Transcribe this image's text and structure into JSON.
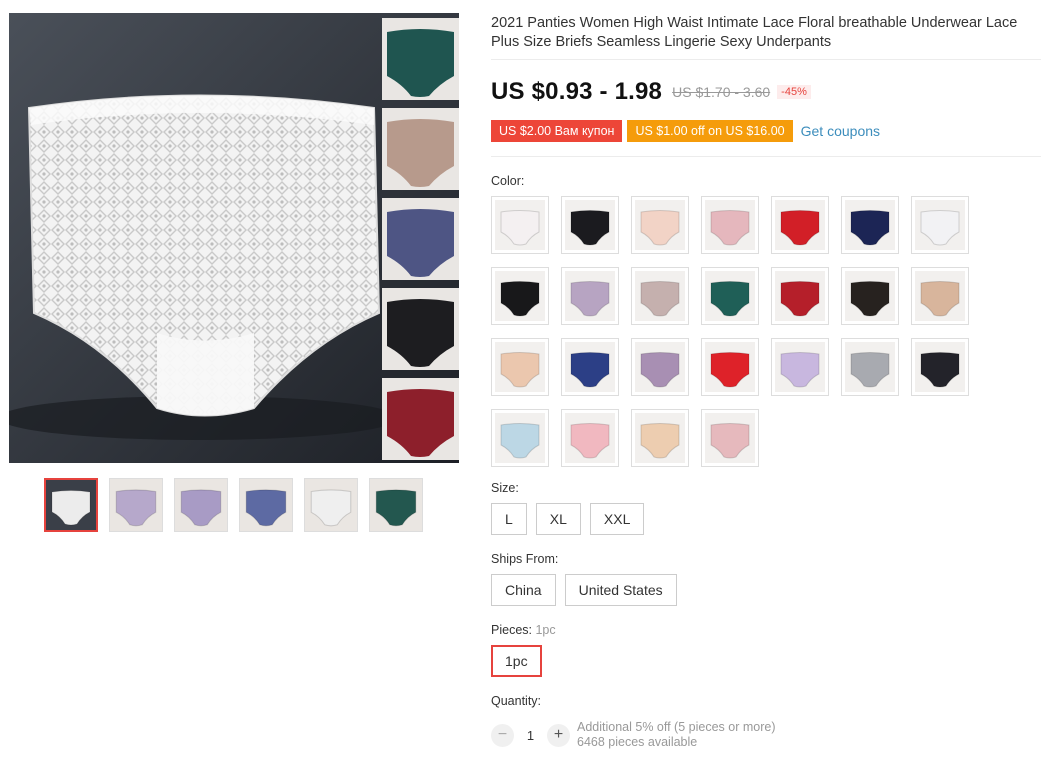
{
  "product": {
    "title": "2021 Panties Women High Waist Intimate Lace Floral breathable Underwear Lace Plus Size Briefs Seamless Lingerie Sexy Underpants"
  },
  "price": {
    "current": "US $0.93 - 1.98",
    "original": "US $1.70 - 3.60",
    "discount": "-45%"
  },
  "coupons": [
    {
      "label": "US $2.00 Вам купон",
      "color": "#ed4638"
    },
    {
      "label": "US $1.00 off on US $16.00",
      "color": "#f59c0b"
    }
  ],
  "get_coupons_label": "Get coupons",
  "color_label": "Color:",
  "colors": [
    "#f4f0f1",
    "#1b1b1f",
    "#f2d3c6",
    "#e5b7bd",
    "#d21f27",
    "#1c2555",
    "#f2f2f4",
    "#18181a",
    "#b7a4c2",
    "#c5b0ae",
    "#1f5f57",
    "#b51f2a",
    "#27221f",
    "#d8b59c",
    "#ebc7ae",
    "#2c3f86",
    "#a88fb3",
    "#de2229",
    "#c8b7df",
    "#a8aab0",
    "#23232a",
    "#bcd7e5",
    "#f1b8c0",
    "#edcdb0",
    "#e6b9bd"
  ],
  "size_label": "Size:",
  "sizes": [
    "L",
    "XL",
    "XXL"
  ],
  "ships_label": "Ships From:",
  "ships": [
    "China",
    "United States"
  ],
  "pieces_label": "Pieces:",
  "pieces_selected": "1pc",
  "pieces": [
    "1pc"
  ],
  "quantity_label": "Quantity:",
  "quantity": {
    "minus": "−",
    "value": "1",
    "plus": "+",
    "note1": "Additional 5% off (5 pieces or more)",
    "note2": "6468 pieces available"
  },
  "gallery": {
    "side_colors": [
      "#1f5550",
      "#b79a8c",
      "#4e5584",
      "#1d1d20",
      "#8d1f2b"
    ],
    "thumb_colors": [
      "#ececec",
      "#b6a8cb",
      "#a89bc5",
      "#5d6aa3",
      "#efefef",
      "#23574f"
    ]
  }
}
